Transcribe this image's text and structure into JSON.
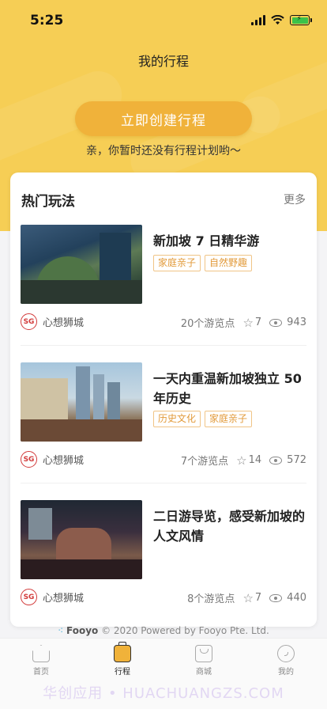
{
  "status": {
    "time": "5:25"
  },
  "header": {
    "title": "我的行程"
  },
  "create_button": {
    "label": "立即创建行程"
  },
  "empty_hint": "亲，你暂时还没有行程计划哟～",
  "popular": {
    "title": "热门玩法",
    "more_label": "更多",
    "items": [
      {
        "name": "新加坡 7 日精华游",
        "tags": [
          "家庭亲子",
          "自然野趣"
        ],
        "author": "心想狮城",
        "author_logo": "SG",
        "spots": "20个游览点",
        "stars": "7",
        "views": "943"
      },
      {
        "name": "一天内重温新加坡独立 50 年历史",
        "tags": [
          "历史文化",
          "家庭亲子"
        ],
        "author": "心想狮城",
        "author_logo": "SG",
        "spots": "7个游览点",
        "stars": "14",
        "views": "572"
      },
      {
        "name": "二日游导览，感受新加坡的人文风情",
        "tags": [],
        "author": "心想狮城",
        "author_logo": "SG",
        "spots": "8个游览点",
        "stars": "7",
        "views": "440"
      }
    ]
  },
  "footer": {
    "brand": "Fooyo",
    "copyright": "© 2020 Powered by Fooyo Pte. Ltd."
  },
  "tabbar": {
    "tabs": [
      {
        "label": "首页",
        "icon": "home-icon"
      },
      {
        "label": "行程",
        "icon": "trip-icon"
      },
      {
        "label": "商城",
        "icon": "shop-icon"
      },
      {
        "label": "我的",
        "icon": "profile-icon"
      }
    ],
    "active": "行程"
  },
  "watermark": "华创应用 • HUACHUANGZS.COM",
  "colors": {
    "accent": "#f0b23a",
    "hero_bg": "#f6ce55",
    "tag": "#e29a3a"
  }
}
